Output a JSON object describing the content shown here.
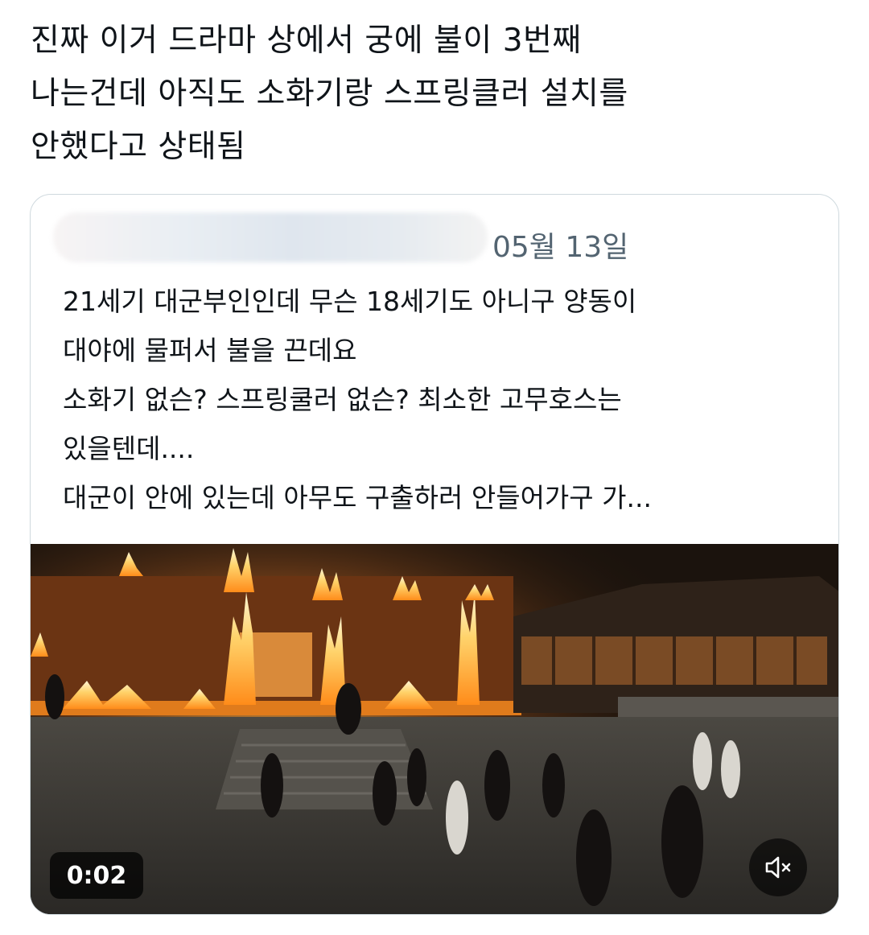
{
  "tweet": {
    "text": "진짜 이거 드라마 상에서 궁에 불이 3번째\n나는건데 아직도 소화기랑 스프링클러 설치를\n안했다고 상태됨"
  },
  "quote": {
    "date": "05월 13일",
    "body": "21세기 대군부인인데 무슨 18세기도 아니구 양동이\n대야에 물퍼서 불을 끈데요\n소화기 없슨? 스프링쿨러 없슨? 최소한 고무호스는\n있을텐데....\n 대군이 안에 있는데 아무도 구출하러 안들어가구 가...",
    "video": {
      "time": "0:02",
      "mute_icon": "speaker-muted-icon"
    }
  }
}
